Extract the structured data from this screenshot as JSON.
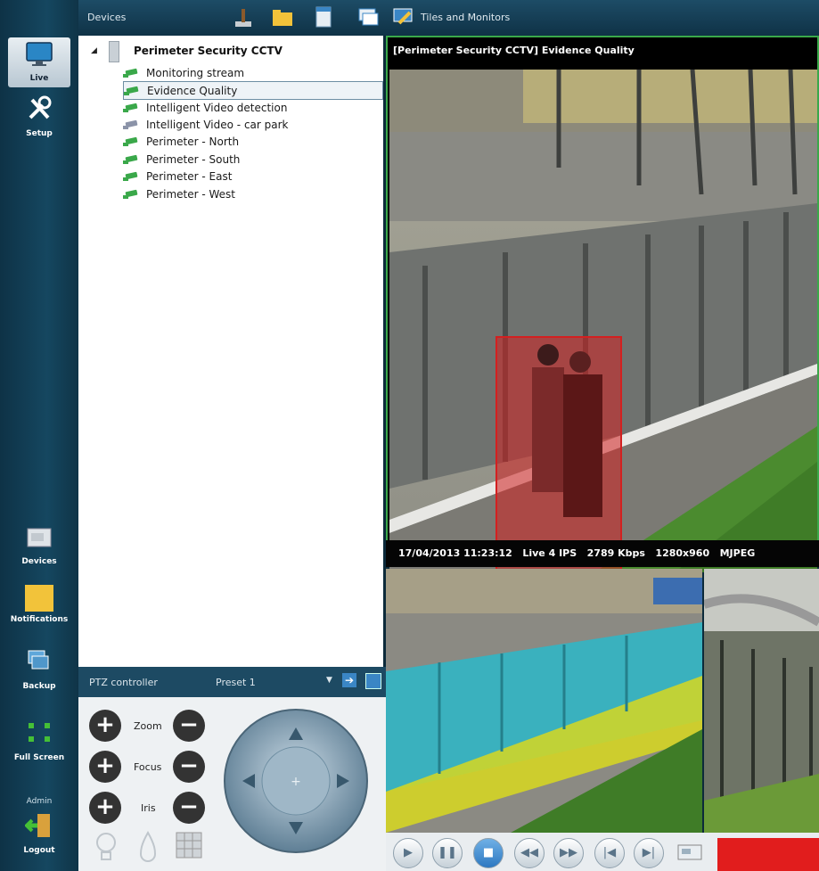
{
  "left_nav": {
    "items": [
      {
        "label": "Live",
        "icon": "monitor-icon"
      },
      {
        "label": "Setup",
        "icon": "tools-icon"
      },
      {
        "label": "Devices",
        "icon": "device-icon"
      },
      {
        "label": "Notifications",
        "icon": "notification-icon"
      },
      {
        "label": "Backup",
        "icon": "backup-icon"
      },
      {
        "label": "Full Screen",
        "icon": "fullscreen-icon"
      }
    ],
    "user": "Admin",
    "logout": "Logout"
  },
  "top_bar": {
    "devices_label": "Devices",
    "tiles_label": "Tiles and Monitors"
  },
  "tree": {
    "root": "Perimeter Security CCTV",
    "items": [
      {
        "label": "Monitoring stream",
        "status": "active"
      },
      {
        "label": "Evidence Quality",
        "status": "active"
      },
      {
        "label": "Intelligent Video detection",
        "status": "active"
      },
      {
        "label": "Intelligent Video - car park",
        "status": "inactive"
      },
      {
        "label": "Perimeter - North",
        "status": "active"
      },
      {
        "label": "Perimeter - South",
        "status": "active"
      },
      {
        "label": "Perimeter - East",
        "status": "active"
      },
      {
        "label": "Perimeter - West",
        "status": "active"
      }
    ]
  },
  "ptz": {
    "title": "PTZ controller",
    "preset": "Preset 1",
    "zoom": "Zoom",
    "focus": "Focus",
    "iris": "Iris"
  },
  "video": {
    "title": "[Perimeter Security CCTV] Evidence Quality",
    "status": {
      "timestamp": "17/04/2013 11:23:12",
      "mode": "Live",
      "ips": "4 IPS",
      "bitrate": "2789 Kbps",
      "resolution": "1280x960",
      "codec": "MJPEG"
    }
  },
  "colors": {
    "active_border": "#3aa84a",
    "detection_box": "#d32020",
    "zone_cyan": "#2bb7c9",
    "zone_yellow": "#d8d820",
    "record": "#e11d1d"
  }
}
